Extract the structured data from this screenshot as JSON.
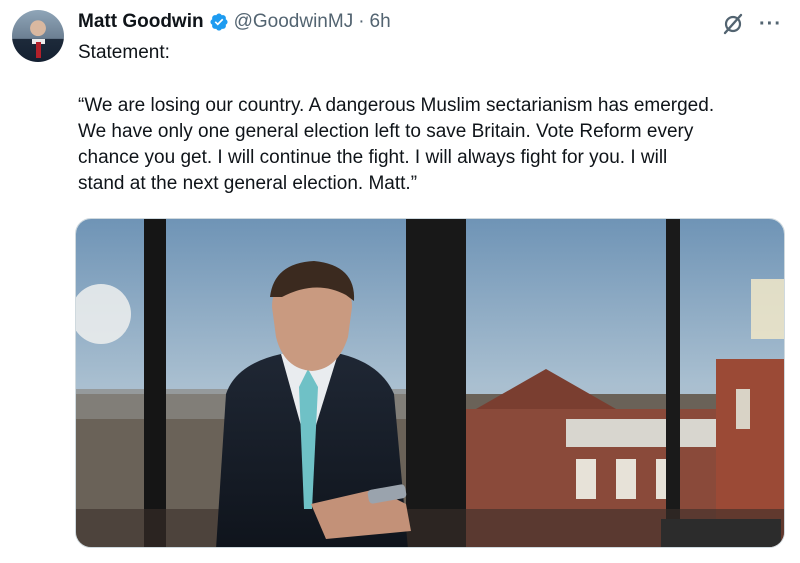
{
  "author": {
    "name": "Matt Goodwin",
    "handle": "@GoodwinMJ",
    "separator": "·",
    "time": "6h",
    "avatar_icon": "profile-photo"
  },
  "post": {
    "label": "Statement:",
    "lines": [
      "“We are losing our country. A dangerous Muslim sectarianism has emerged.",
      "We have only one general election left to save Britain. Vote Reform every",
      "chance you get. I will continue the fight. I will always fight for you. I will",
      "stand at the next general election. Matt.”"
    ]
  },
  "icons": {
    "verified": "verified-badge-icon",
    "grok": "grok-icon",
    "more": "more-icon"
  },
  "colors": {
    "verified_blue": "#1d9bf0",
    "muted": "#536471",
    "text": "#0f1419"
  }
}
